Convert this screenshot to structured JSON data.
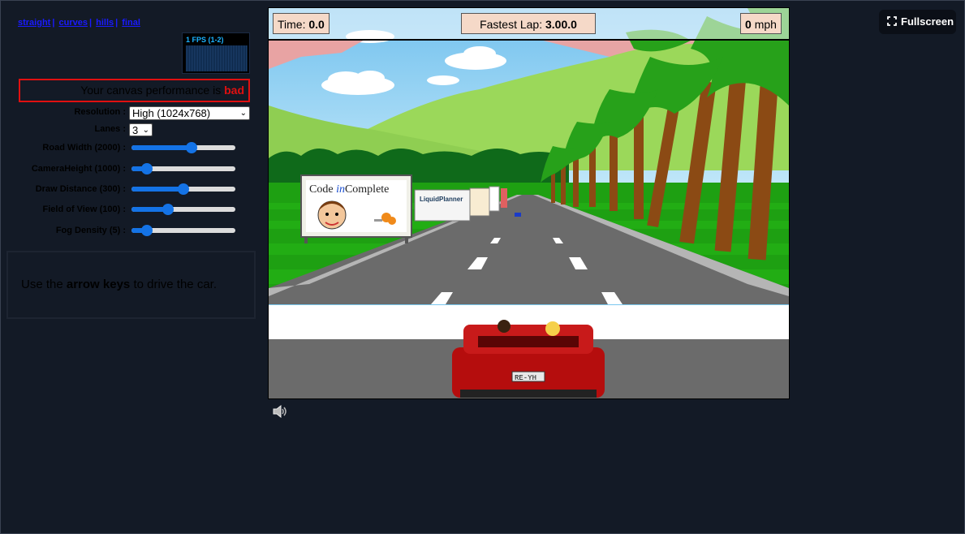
{
  "links": [
    "straight",
    "curves",
    "hills",
    "final"
  ],
  "fps": {
    "label": "1 FPS (1-2)"
  },
  "performance": {
    "text": "Your canvas performance is",
    "status": "bad"
  },
  "controls": {
    "resolution": {
      "label": "Resolution :",
      "value": "High (1024x768)"
    },
    "lanes": {
      "label": "Lanes :",
      "value": "3"
    },
    "sliders": [
      {
        "label": "Road Width (2000) :",
        "fraction": 0.58
      },
      {
        "label": "CameraHeight (1000) :",
        "fraction": 0.15
      },
      {
        "label": "Draw Distance (300) :",
        "fraction": 0.5
      },
      {
        "label": "Field of View (100) :",
        "fraction": 0.35
      },
      {
        "label": "Fog Density (5) :",
        "fraction": 0.15
      }
    ]
  },
  "instructions": {
    "prefix": "Use the",
    "keys": "arrow keys",
    "suffix": "to drive the car."
  },
  "hud": {
    "time_label": "Time:",
    "time_value": "0.0",
    "fastest_label": "Fastest Lap:",
    "fastest_value": "3.00.0",
    "speed_value": "0",
    "speed_unit": "mph"
  },
  "billboard": {
    "line1a": "Code ",
    "line1b": "in",
    "line1c": "Complete"
  },
  "billboard2": {
    "text": "LiquidPlanner"
  },
  "plate": "RE-YH",
  "fullscreen": {
    "label": "Fullscreen"
  },
  "colors": {
    "accent": "#1473e6",
    "bad": "#e01010",
    "bg": "#131a26"
  }
}
